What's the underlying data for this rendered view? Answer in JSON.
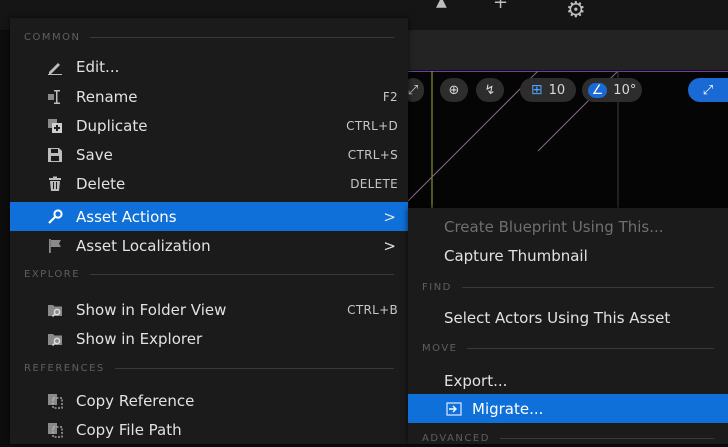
{
  "menu": {
    "sections": {
      "common": "COMMON",
      "explore": "EXPLORE",
      "references": "REFERENCES"
    },
    "items": {
      "edit": {
        "label": "Edit...",
        "icon": "pencil-icon"
      },
      "rename": {
        "label": "Rename",
        "shortcut": "F2",
        "icon": "rename-icon"
      },
      "duplicate": {
        "label": "Duplicate",
        "shortcut": "CTRL+D",
        "icon": "duplicate-icon"
      },
      "save": {
        "label": "Save",
        "shortcut": "CTRL+S",
        "icon": "save-icon"
      },
      "delete": {
        "label": "Delete",
        "shortcut": "DELETE",
        "icon": "trash-icon"
      },
      "asset_actions": {
        "label": "Asset Actions",
        "arrow": ">",
        "icon": "wrench-icon",
        "highlighted": true
      },
      "asset_localization": {
        "label": "Asset Localization",
        "arrow": ">",
        "icon": "flag-icon"
      },
      "show_folder": {
        "label": "Show in Folder View",
        "shortcut": "CTRL+B",
        "icon": "folder-search-icon"
      },
      "show_explorer": {
        "label": "Show in Explorer",
        "icon": "folder-search-icon"
      },
      "copy_reference": {
        "label": "Copy Reference",
        "icon": "copy-icon"
      },
      "copy_file_path": {
        "label": "Copy File Path",
        "icon": "copy-icon"
      }
    }
  },
  "submenu": {
    "sections": {
      "find": "FIND",
      "move": "MOVE",
      "advanced": "ADVANCED"
    },
    "items": {
      "create_blueprint": "Create Blueprint Using This...",
      "capture_thumbnail": "Capture Thumbnail",
      "select_actors": "Select Actors Using This Asset",
      "export": "Export...",
      "migrate": "Migrate..."
    }
  },
  "viewport": {
    "grid_snap": "10",
    "rotation_snap": "10°"
  },
  "colors": {
    "highlight": "#0f70d9",
    "menu_bg": "#1b1b1b",
    "viewport_accent": "#1a6ad6"
  }
}
